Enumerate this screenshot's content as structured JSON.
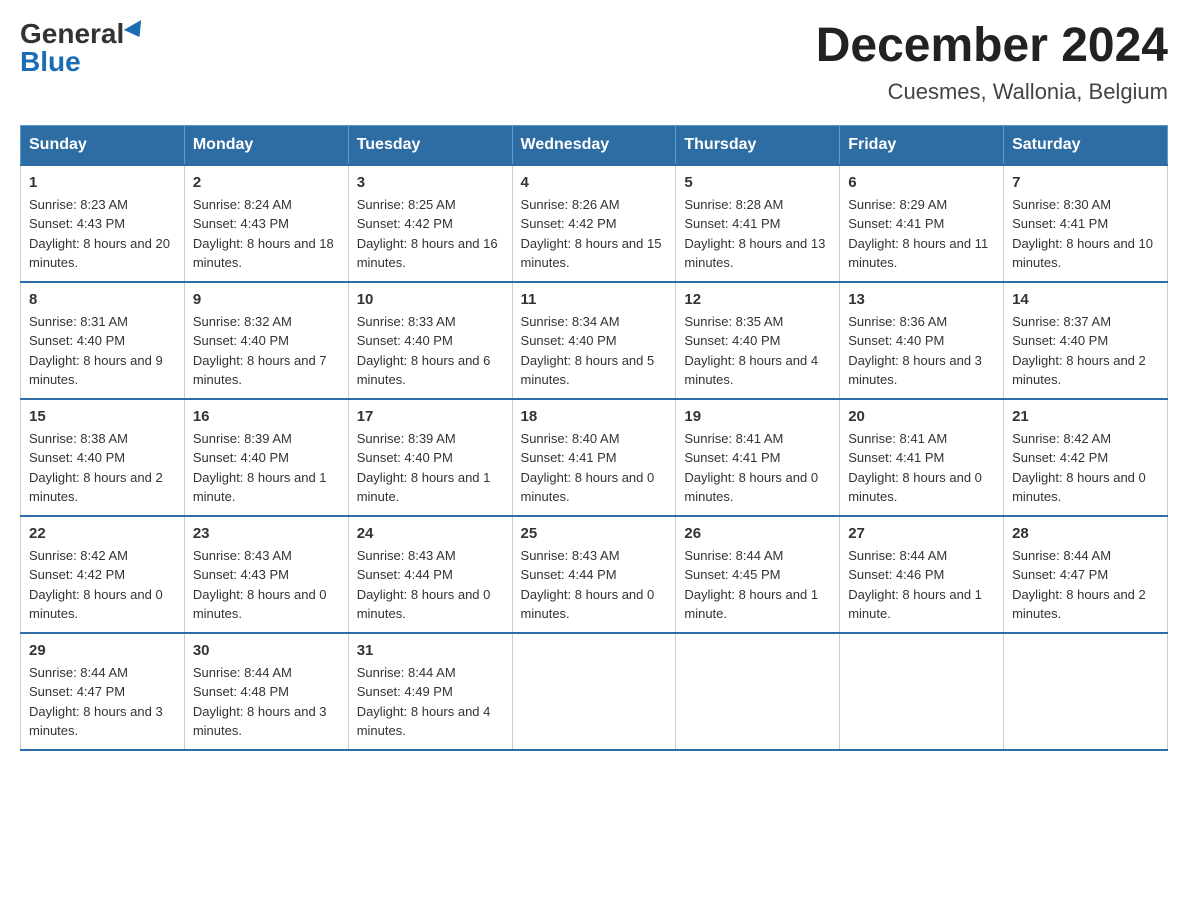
{
  "logo": {
    "general": "General",
    "blue": "Blue"
  },
  "title": "December 2024",
  "subtitle": "Cuesmes, Wallonia, Belgium",
  "days_of_week": [
    "Sunday",
    "Monday",
    "Tuesday",
    "Wednesday",
    "Thursday",
    "Friday",
    "Saturday"
  ],
  "weeks": [
    [
      {
        "day": "1",
        "sunrise": "8:23 AM",
        "sunset": "4:43 PM",
        "daylight": "8 hours and 20 minutes."
      },
      {
        "day": "2",
        "sunrise": "8:24 AM",
        "sunset": "4:43 PM",
        "daylight": "8 hours and 18 minutes."
      },
      {
        "day": "3",
        "sunrise": "8:25 AM",
        "sunset": "4:42 PM",
        "daylight": "8 hours and 16 minutes."
      },
      {
        "day": "4",
        "sunrise": "8:26 AM",
        "sunset": "4:42 PM",
        "daylight": "8 hours and 15 minutes."
      },
      {
        "day": "5",
        "sunrise": "8:28 AM",
        "sunset": "4:41 PM",
        "daylight": "8 hours and 13 minutes."
      },
      {
        "day": "6",
        "sunrise": "8:29 AM",
        "sunset": "4:41 PM",
        "daylight": "8 hours and 11 minutes."
      },
      {
        "day": "7",
        "sunrise": "8:30 AM",
        "sunset": "4:41 PM",
        "daylight": "8 hours and 10 minutes."
      }
    ],
    [
      {
        "day": "8",
        "sunrise": "8:31 AM",
        "sunset": "4:40 PM",
        "daylight": "8 hours and 9 minutes."
      },
      {
        "day": "9",
        "sunrise": "8:32 AM",
        "sunset": "4:40 PM",
        "daylight": "8 hours and 7 minutes."
      },
      {
        "day": "10",
        "sunrise": "8:33 AM",
        "sunset": "4:40 PM",
        "daylight": "8 hours and 6 minutes."
      },
      {
        "day": "11",
        "sunrise": "8:34 AM",
        "sunset": "4:40 PM",
        "daylight": "8 hours and 5 minutes."
      },
      {
        "day": "12",
        "sunrise": "8:35 AM",
        "sunset": "4:40 PM",
        "daylight": "8 hours and 4 minutes."
      },
      {
        "day": "13",
        "sunrise": "8:36 AM",
        "sunset": "4:40 PM",
        "daylight": "8 hours and 3 minutes."
      },
      {
        "day": "14",
        "sunrise": "8:37 AM",
        "sunset": "4:40 PM",
        "daylight": "8 hours and 2 minutes."
      }
    ],
    [
      {
        "day": "15",
        "sunrise": "8:38 AM",
        "sunset": "4:40 PM",
        "daylight": "8 hours and 2 minutes."
      },
      {
        "day": "16",
        "sunrise": "8:39 AM",
        "sunset": "4:40 PM",
        "daylight": "8 hours and 1 minute."
      },
      {
        "day": "17",
        "sunrise": "8:39 AM",
        "sunset": "4:40 PM",
        "daylight": "8 hours and 1 minute."
      },
      {
        "day": "18",
        "sunrise": "8:40 AM",
        "sunset": "4:41 PM",
        "daylight": "8 hours and 0 minutes."
      },
      {
        "day": "19",
        "sunrise": "8:41 AM",
        "sunset": "4:41 PM",
        "daylight": "8 hours and 0 minutes."
      },
      {
        "day": "20",
        "sunrise": "8:41 AM",
        "sunset": "4:41 PM",
        "daylight": "8 hours and 0 minutes."
      },
      {
        "day": "21",
        "sunrise": "8:42 AM",
        "sunset": "4:42 PM",
        "daylight": "8 hours and 0 minutes."
      }
    ],
    [
      {
        "day": "22",
        "sunrise": "8:42 AM",
        "sunset": "4:42 PM",
        "daylight": "8 hours and 0 minutes."
      },
      {
        "day": "23",
        "sunrise": "8:43 AM",
        "sunset": "4:43 PM",
        "daylight": "8 hours and 0 minutes."
      },
      {
        "day": "24",
        "sunrise": "8:43 AM",
        "sunset": "4:44 PM",
        "daylight": "8 hours and 0 minutes."
      },
      {
        "day": "25",
        "sunrise": "8:43 AM",
        "sunset": "4:44 PM",
        "daylight": "8 hours and 0 minutes."
      },
      {
        "day": "26",
        "sunrise": "8:44 AM",
        "sunset": "4:45 PM",
        "daylight": "8 hours and 1 minute."
      },
      {
        "day": "27",
        "sunrise": "8:44 AM",
        "sunset": "4:46 PM",
        "daylight": "8 hours and 1 minute."
      },
      {
        "day": "28",
        "sunrise": "8:44 AM",
        "sunset": "4:47 PM",
        "daylight": "8 hours and 2 minutes."
      }
    ],
    [
      {
        "day": "29",
        "sunrise": "8:44 AM",
        "sunset": "4:47 PM",
        "daylight": "8 hours and 3 minutes."
      },
      {
        "day": "30",
        "sunrise": "8:44 AM",
        "sunset": "4:48 PM",
        "daylight": "8 hours and 3 minutes."
      },
      {
        "day": "31",
        "sunrise": "8:44 AM",
        "sunset": "4:49 PM",
        "daylight": "8 hours and 4 minutes."
      },
      null,
      null,
      null,
      null
    ]
  ],
  "labels": {
    "sunrise": "Sunrise:",
    "sunset": "Sunset:",
    "daylight": "Daylight:"
  }
}
